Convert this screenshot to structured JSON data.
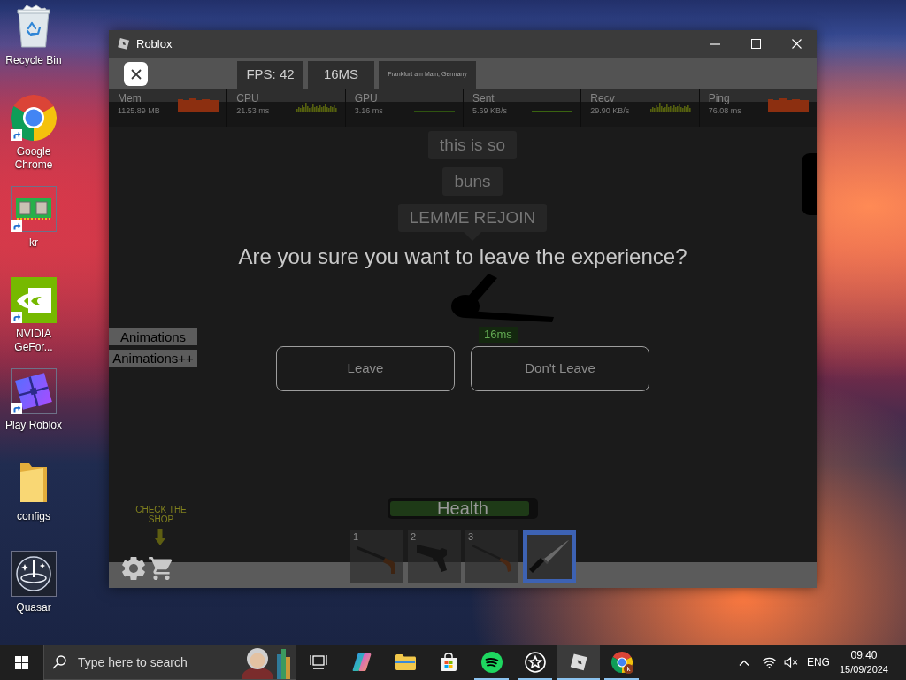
{
  "desktop": {
    "icons": [
      {
        "label": "Recycle Bin",
        "kind": "recycle-bin",
        "shortcut": false
      },
      {
        "label": "Google Chrome",
        "kind": "chrome",
        "shortcut": true
      },
      {
        "label": "kr",
        "kind": "memory",
        "shortcut": true
      },
      {
        "label": "NVIDIA GeFor...",
        "kind": "nvidia",
        "shortcut": true
      },
      {
        "label": "Play Roblox",
        "kind": "roblox",
        "shortcut": true
      },
      {
        "label": "configs",
        "kind": "folder",
        "shortcut": false
      },
      {
        "label": "Quasar",
        "kind": "quasar",
        "shortcut": false
      }
    ]
  },
  "window": {
    "title": "Roblox"
  },
  "game": {
    "top_bar": {
      "fps": "FPS: 42",
      "ping": "16MS",
      "server": "Frankfurt am Main, Germany"
    },
    "stats": [
      {
        "label": "Mem",
        "value": "1125.89 MB",
        "kind": "area",
        "color": "#8c2f10"
      },
      {
        "label": "CPU",
        "value": "21.53 ms",
        "kind": "bars",
        "color": "#55600f"
      },
      {
        "label": "GPU",
        "value": "3.16 ms",
        "kind": "line",
        "color": "#2f5410"
      },
      {
        "label": "Sent",
        "value": "5.69 KB/s",
        "kind": "line",
        "color": "#3a6410"
      },
      {
        "label": "Recv",
        "value": "29.90 KB/s",
        "kind": "bars",
        "color": "#55600f"
      },
      {
        "label": "Ping",
        "value": "76.08 ms",
        "kind": "area",
        "color": "#8c2f10"
      }
    ],
    "chat_bubbles": [
      {
        "text": "this is so",
        "tail": false
      },
      {
        "text": "buns",
        "tail": false
      },
      {
        "text": "LEMME REJOIN",
        "tail": true
      }
    ],
    "player_tag": "16ms",
    "side_buttons": [
      "Animations",
      "Animations++"
    ],
    "shop_hint": "CHECK THE SHOP",
    "health": {
      "label": "Health",
      "level": 0.96
    },
    "hotbar": [
      {
        "number": "1",
        "kind": "shotgun",
        "selected": false
      },
      {
        "number": "2",
        "kind": "revolver",
        "selected": false
      },
      {
        "number": "3",
        "kind": "rifle",
        "selected": false
      },
      {
        "kind": "knife",
        "selected": true
      }
    ],
    "dialog": {
      "question": "Are you sure you want to leave the experience?",
      "buttons": [
        "Leave",
        "Don't Leave"
      ]
    }
  },
  "taskbar": {
    "search": {
      "placeholder": "Type here to search"
    },
    "apps": [
      {
        "kind": "task-view",
        "running": false,
        "selected": false
      },
      {
        "kind": "copilot",
        "running": false,
        "selected": false
      },
      {
        "kind": "explorer",
        "running": false,
        "selected": false
      },
      {
        "kind": "store",
        "running": false,
        "selected": false
      },
      {
        "kind": "spotify",
        "running": true,
        "selected": false
      },
      {
        "kind": "star",
        "running": true,
        "selected": false
      },
      {
        "kind": "roblox",
        "running": true,
        "selected": true
      },
      {
        "kind": "chrome",
        "running": true,
        "selected": false,
        "badge": "k"
      }
    ],
    "tray": {
      "muted": true,
      "language": "ENG",
      "time": "09:40",
      "date": "15/09/2024"
    }
  }
}
